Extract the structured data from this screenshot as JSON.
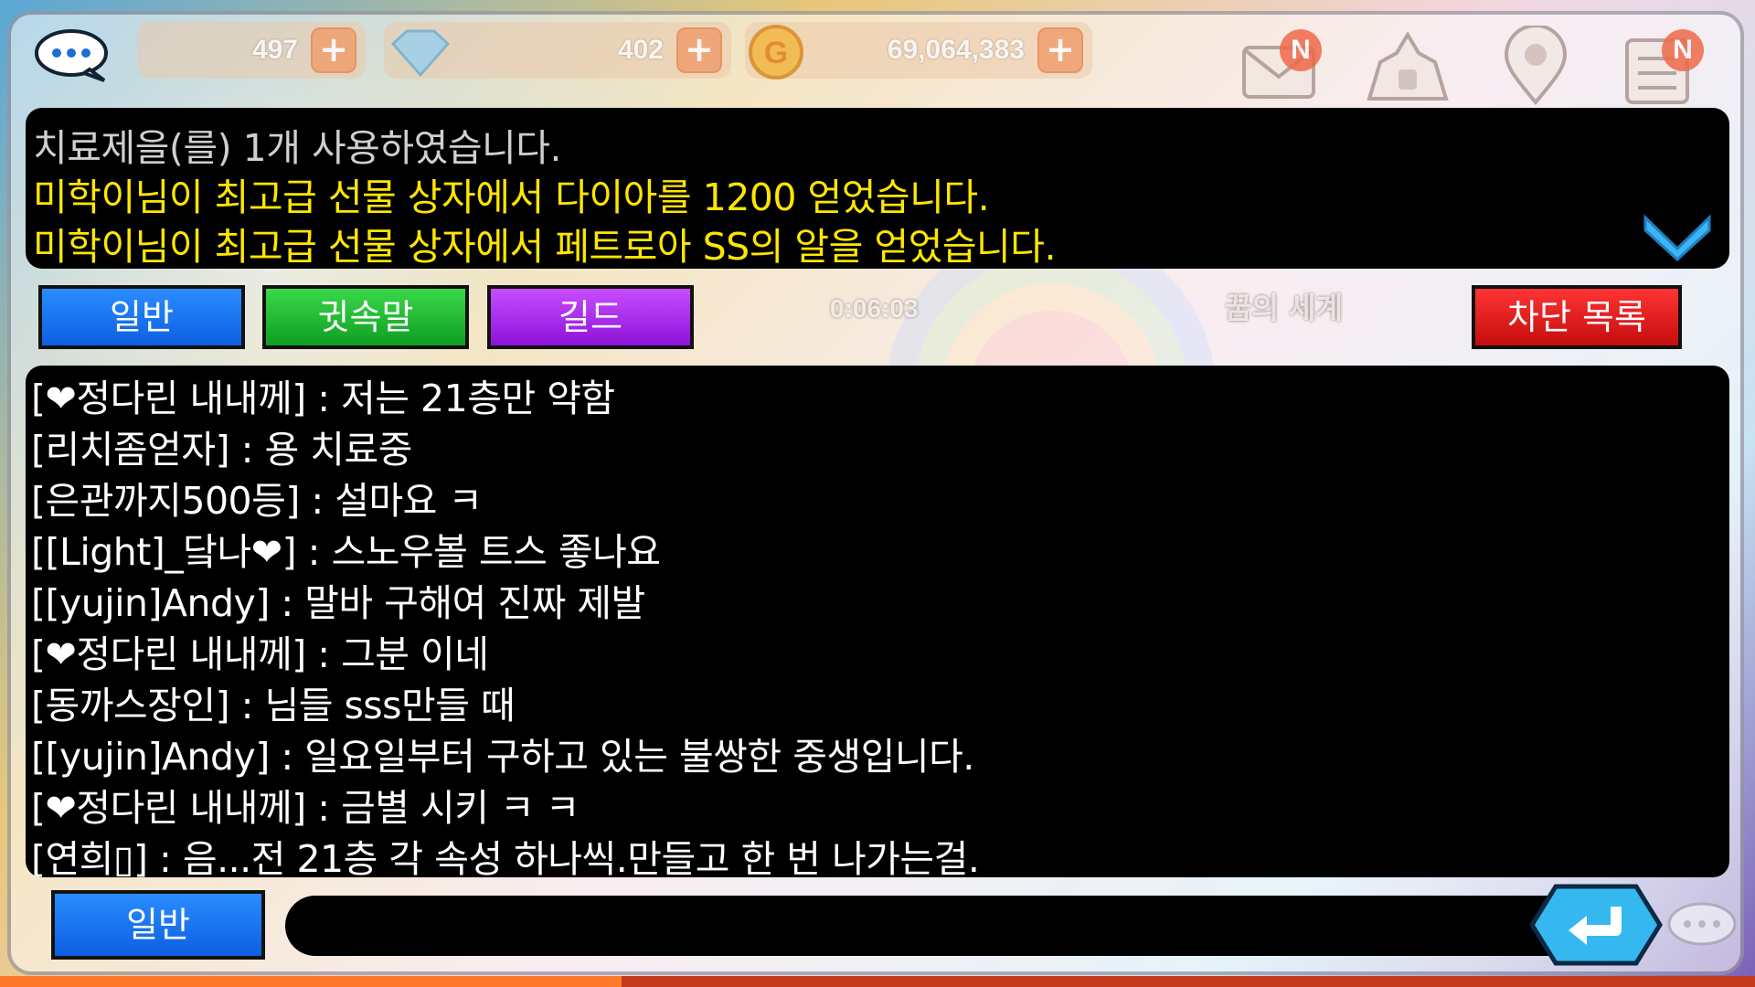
{
  "top_bar": {
    "currency_1": "497",
    "currency_2": "402",
    "currency_3": "69,064,383",
    "plus_label": "+",
    "badge_label": "N"
  },
  "system_log": [
    {
      "text": "치료제을(를) 1개 사용하였습니다.",
      "color": "#cfcfcf"
    },
    {
      "text": "미학이님이 최고급 선물 상자에서 다이아를 1200 얻었습니다.",
      "color": "#ffe600"
    },
    {
      "text": "미학이님이 최고급 선물 상자에서 페트로아 SS의 알을 얻었습니다.",
      "color": "#ffe600"
    }
  ],
  "tabs": {
    "general": "일반",
    "whisper": "귓속말",
    "guild": "길드",
    "block_list": "차단 목록"
  },
  "timer": "0:06:03",
  "world_label": "꿈의 세계",
  "chat_lines": [
    "[❤정다린 내내께] : 저는 21층만 약함",
    "[리치좀얻자] : 용 치료중",
    "[은관까지500등] : 설마요 ㅋ",
    "[[Light]_닼나❤] : 스노우볼 트스 좋나요",
    "[[yujin]Andy] : 말바 구해여 진짜 제발",
    "[❤정다린 내내께] : 그분 이네",
    "[동까스장인] : 님들 sss만들 때",
    "[[yujin]Andy] : 일요일부터 구하고 있는 불쌍한 중생입니다.",
    "[❤정다린 내내께] : 금별 시키 ㅋ ㅋ",
    "[연희▯] : 음...전 21층 각 속성 하나씩.만들고 한 번 나가는걸."
  ],
  "input": {
    "channel": "일반",
    "value": ""
  },
  "colors": {
    "tab_general": "#1a76f0",
    "tab_whisper": "#22c030",
    "tab_guild": "#a52ee8",
    "tab_block": "#e01e1e",
    "system_yellow": "#ffe600"
  }
}
